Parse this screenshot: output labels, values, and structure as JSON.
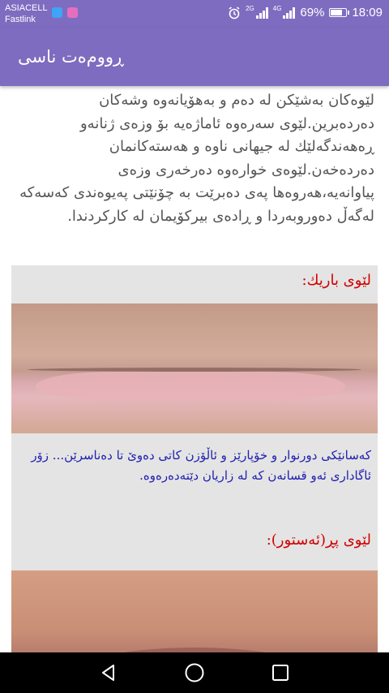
{
  "status_bar": {
    "carrier_line1": "ASIACELL",
    "carrier_line2": "Fastlink",
    "network_2g": "2G",
    "network_4g": "4G",
    "battery_percent": "69%",
    "battery_level": 0.69,
    "time": "18:09"
  },
  "app_bar": {
    "title": "ڕووم‌ەت ناسی"
  },
  "content": {
    "intro": "لێوەكان بەشێكن لە دەم و بەهۆیانەوە وشەكان دەردەبرین.لێوی سەرەوە ئاماژەیە بۆ وزەی ژنانەو ڕەهەندگەلێك لە جیهانی ناوە و هەستەكانمان دەردەخەن.لێوەی خوارەوە دەرخەری وزەی پیاوانەیە،هەروەها پەی دەبرێت بە چۆنێتی پەیوەندی كەسەكە لەگەڵ دەوروبەردا و ڕادەی بیركۆیمان لە كاركردندا.",
    "section1_heading": "لێوی باریك:",
    "section1_text": "كەسانێكی دورنوار و خۆپارێز و ئاڵۆزن كاتی دەوێ تا دەناسرێن... زۆر ئاگاداری ئەو قسانەن كە لە زاریان دێتەدەرەوە.",
    "section2_heading": "لێوی پڕ(ئەستور):"
  },
  "navigation": {
    "back_icon": "back-triangle",
    "home_icon": "home-circle",
    "recent_icon": "recent-square"
  }
}
